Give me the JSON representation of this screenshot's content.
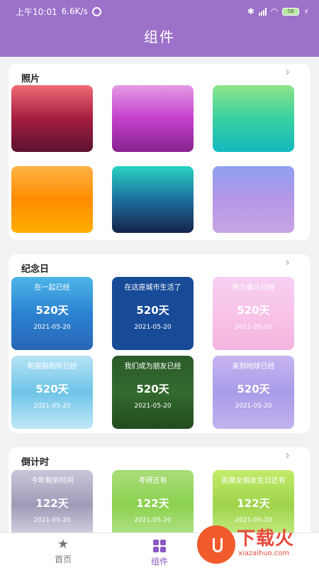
{
  "status": {
    "time": "上午10:01",
    "speed": "6.6K/s",
    "battery": "56"
  },
  "header": {
    "title": "组件"
  },
  "sections": {
    "photos": {
      "title": "照片"
    },
    "anniversary": {
      "title": "纪念日",
      "items": [
        {
          "title": "在一起已经",
          "days": "520天",
          "date": "2021-05-20"
        },
        {
          "title": "在这座城市生活了",
          "days": "520天",
          "date": "2021-05-20"
        },
        {
          "title": "努力奋斗已经",
          "days": "520天",
          "date": "2021-05-20"
        },
        {
          "title": "和猫猫相伴已经",
          "days": "520天",
          "date": "2021-05-20"
        },
        {
          "title": "我们成为朋友已经",
          "days": "520天",
          "date": "2021-05-20"
        },
        {
          "title": "来到地球已经",
          "days": "520天",
          "date": "2021-05-20"
        }
      ]
    },
    "countdown": {
      "title": "倒计时",
      "items": [
        {
          "title": "今年剩余时间",
          "days": "122天",
          "date": "2021-05-20"
        },
        {
          "title": "考研还有",
          "days": "122天",
          "date": "2021-05-20"
        },
        {
          "title": "距离女朋友生日还有",
          "days": "122天",
          "date": "2021-05-20"
        }
      ]
    }
  },
  "tabs": {
    "home": "首页",
    "widgets": "组件"
  },
  "watermark": {
    "brand": "下载火",
    "domain": "xiazaihuo.com"
  },
  "colors": {
    "header": "#9b71c9",
    "accent": "#8a58c4"
  }
}
